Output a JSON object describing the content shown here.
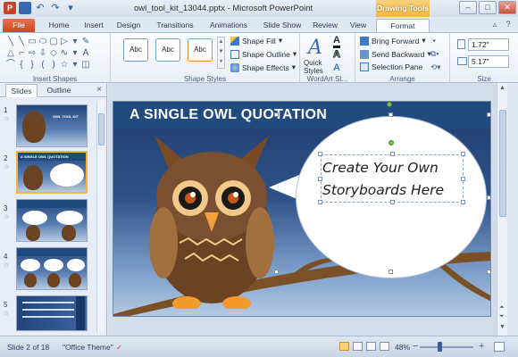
{
  "window": {
    "app_icon_letter": "P",
    "title": "owl_tool_kit_13044.pptx - Microsoft PowerPoint",
    "contextual_tab_group": "Drawing Tools",
    "controls": {
      "minimize": "–",
      "maximize": "□",
      "close": "✕"
    }
  },
  "tabs": [
    "File",
    "Home",
    "Insert",
    "Design",
    "Transitions",
    "Animations",
    "Slide Show",
    "Review",
    "View",
    "Format"
  ],
  "ribbon": {
    "groups": {
      "insert_shapes": "Insert Shapes",
      "shape_styles": "Shape Styles",
      "wordart_styles": "WordArt St...",
      "arrange": "Arrange",
      "size": "Size"
    },
    "style_presets": [
      "Abc",
      "Abc",
      "Abc"
    ],
    "shape_fill": "Shape Fill",
    "shape_outline": "Shape Outline",
    "shape_effects": "Shape Effects",
    "quick_styles": "Quick Styles",
    "bring_forward": "Bring Forward",
    "send_backward": "Send Backward",
    "selection_pane": "Selection Pane",
    "height": "1.72\"",
    "width": "5.17\""
  },
  "panel": {
    "tab_slides": "Slides",
    "tab_outline": "Outline",
    "close": "×",
    "thumbnails": [
      {
        "num": "1",
        "label": "OWL TOOL KIT",
        "selected": false
      },
      {
        "num": "2",
        "label": "A SINGLE OWL QUOTATION",
        "selected": true
      },
      {
        "num": "3",
        "label": "",
        "selected": false
      },
      {
        "num": "4",
        "label": "",
        "selected": false
      },
      {
        "num": "5",
        "label": "",
        "selected": false
      }
    ]
  },
  "slide": {
    "title": "A SINGLE OWL QUOTATION",
    "quote_line1": "Create Your Own",
    "quote_line2": "Storyboards Here"
  },
  "status": {
    "slide_info": "Slide 2 of 18",
    "theme": "\"Office Theme\"",
    "zoom": "48%",
    "zoom_minus": "−",
    "zoom_plus": "+"
  },
  "colors": {
    "title_bar_bg": "#214a7e",
    "contextual_accent": "#f2b63e",
    "file_tab": "#c8481f"
  }
}
